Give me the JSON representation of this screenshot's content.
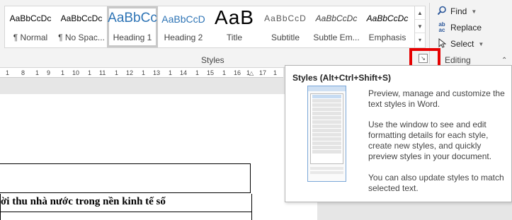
{
  "ribbon": {
    "style_gallery": [
      {
        "preview": "AaBbCcDc",
        "name": "¶ Normal"
      },
      {
        "preview": "AaBbCcDc",
        "name": "¶ No Spac..."
      },
      {
        "preview": "AaBbCc",
        "name": "Heading 1"
      },
      {
        "preview": "AaBbCcD",
        "name": "Heading 2"
      },
      {
        "preview": "AaB",
        "name": "Title"
      },
      {
        "preview": "AaBbCcD",
        "name": "Subtitle"
      },
      {
        "preview": "AaBbCcDc",
        "name": "Subtle Em..."
      },
      {
        "preview": "AaBbCcDc",
        "name": "Emphasis"
      }
    ],
    "styles_group_label": "Styles",
    "editing_group_label": "Editing",
    "editing": {
      "find": "Find",
      "replace": "Replace",
      "select": "Select"
    }
  },
  "ruler": {
    "ticks": [
      "1",
      "8",
      "1",
      "9",
      "1",
      "10",
      "1",
      "11",
      "1",
      "12",
      "1",
      "13",
      "1",
      "14",
      "1",
      "15",
      "1",
      "16",
      "1",
      "17",
      "1"
    ]
  },
  "tooltip": {
    "title": "Styles (Alt+Ctrl+Shift+S)",
    "para1": "Preview, manage and customize the text styles in Word.",
    "para2": "Use the window to see and edit formatting details for each style, create new styles, and quickly preview styles in your document.",
    "para3": "You can also update styles to match selected text."
  },
  "document": {
    "line_text": "ời thu nhà nước trong nền kinh tế số"
  },
  "colors": {
    "highlight": "#e60000",
    "heading_blue": "#2e74b5"
  },
  "icons": {
    "find": "search-icon",
    "replace": "replace-icon",
    "select": "cursor-icon",
    "launcher": "dialog-launcher-icon"
  }
}
